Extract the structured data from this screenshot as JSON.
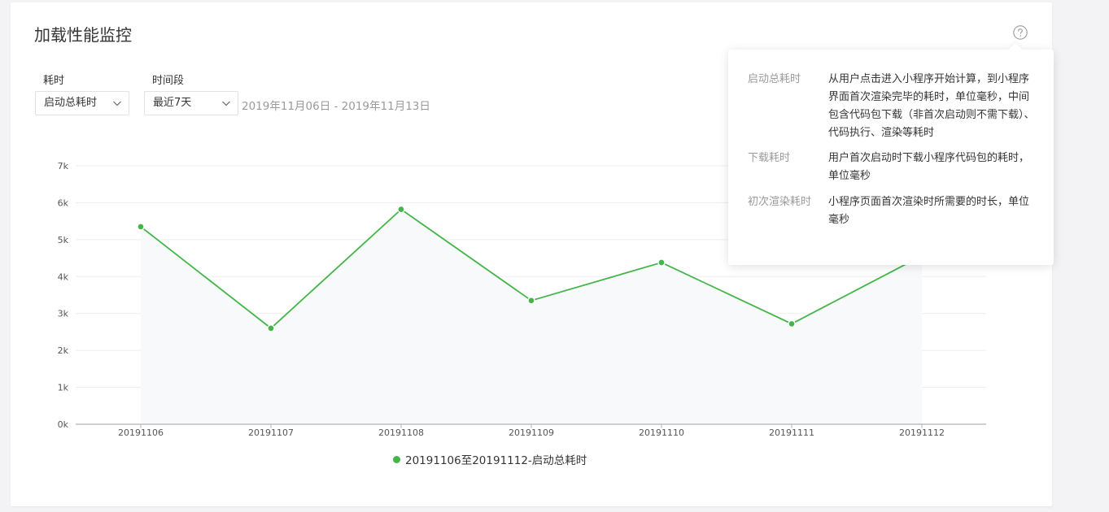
{
  "page": {
    "title": "加载性能监控"
  },
  "filters": {
    "metric_label": "耗时",
    "metric_value": "启动总耗时",
    "period_label": "时间段",
    "period_value": "最近7天",
    "date_range": "2019年11月06日 - 2019年11月13日"
  },
  "help_icon": "question-circle",
  "chart_data": {
    "type": "line",
    "x": [
      "20191106",
      "20191107",
      "20191108",
      "20191109",
      "20191110",
      "20191111",
      "20191112"
    ],
    "series": [
      {
        "name": "20191106至20191112-启动总耗时",
        "values": [
          5350,
          2600,
          5820,
          3350,
          4380,
          2720,
          4560
        ]
      }
    ],
    "y_ticks": [
      "0k",
      "1k",
      "2k",
      "3k",
      "4k",
      "5k",
      "6k",
      "7k"
    ],
    "ylim": [
      0,
      7000
    ],
    "grid": true,
    "line_color": "#44b549",
    "area_color": "#f8f9fb",
    "legend_position": "bottom"
  },
  "legend": {
    "label": "20191106至20191112-启动总耗时"
  },
  "tooltip": {
    "items": [
      {
        "term": "启动总耗时",
        "desc": "从用户点击进入小程序开始计算，到小程序界面首次渲染完毕的耗时，单位毫秒，中间包含代码包下载（非首次启动则不需下载）、代码执行、渲染等耗时"
      },
      {
        "term": "下载耗时",
        "desc": "用户首次启动时下载小程序代码包的耗时，单位毫秒"
      },
      {
        "term": "初次渲染耗时",
        "desc": "小程序页面首次渲染时所需要的时长，单位毫秒"
      }
    ]
  }
}
